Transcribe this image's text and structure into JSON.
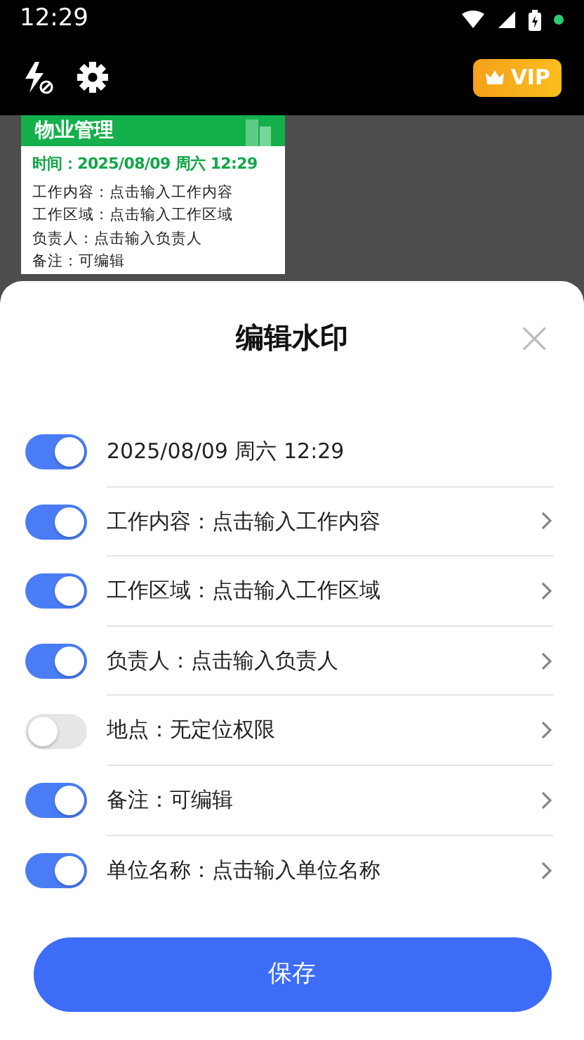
{
  "status_bar": {
    "time": "12:29"
  },
  "toolbar": {
    "vip_label": "VIP"
  },
  "watermark_card": {
    "title": "物业管理",
    "time_line": "时间：2025/08/09 周六 12:29",
    "lines": [
      "工作内容：点击输入工作内容",
      "工作区域：点击输入工作区域",
      "负责人：点击输入负责人",
      "备注：可编辑"
    ]
  },
  "sheet": {
    "title": "编辑水印",
    "close": "×",
    "items": [
      {
        "text": "2025/08/09 周六 12:29",
        "on": true,
        "arrow": false
      },
      {
        "text": "工作内容：点击输入工作内容",
        "on": true,
        "arrow": true
      },
      {
        "text": "工作区域：点击输入工作区域",
        "on": true,
        "arrow": true
      },
      {
        "text": "负责人：点击输入负责人",
        "on": true,
        "arrow": true
      },
      {
        "text": "地点：无定位权限",
        "on": false,
        "arrow": true
      },
      {
        "text": "备注：可编辑",
        "on": true,
        "arrow": true
      },
      {
        "text": "单位名称：点击输入单位名称",
        "on": true,
        "arrow": true
      }
    ],
    "save_button": "保存"
  }
}
